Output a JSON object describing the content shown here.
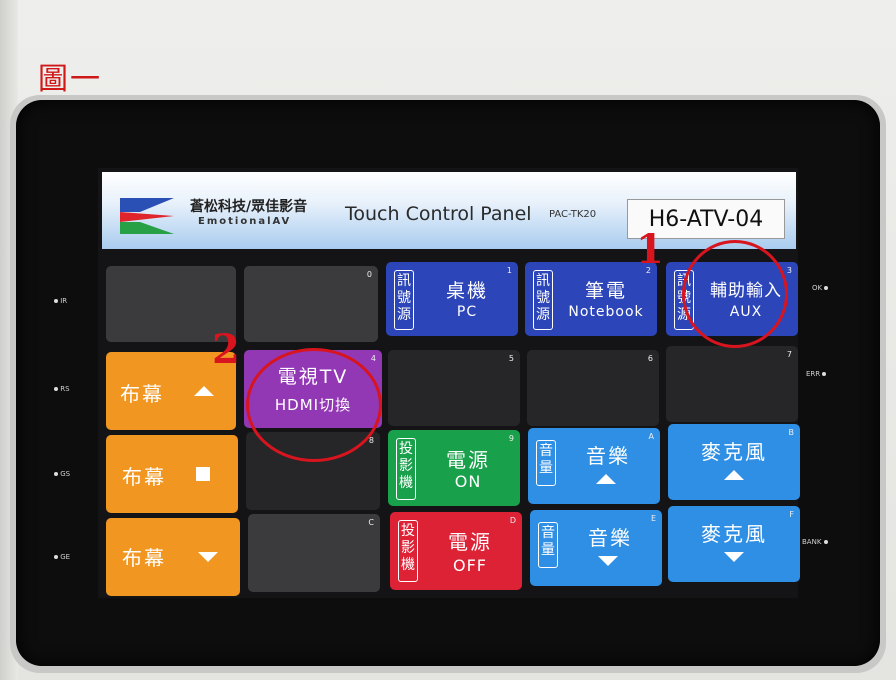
{
  "figure_label": "圖一",
  "panel": {
    "company_cn": "蒼松科技/眾佳影音",
    "company_en": "EmotionalAV",
    "title": "Touch Control Panel",
    "model": "PAC-TK20",
    "device_label": "H6-ATV-04"
  },
  "indicators": [
    "IR",
    "RS",
    "GS",
    "GE",
    "OK",
    "ERR",
    "BANK"
  ],
  "signal_tag": "訊號源",
  "projector_tag": "投影機",
  "volume_tag": "音量",
  "buttons": {
    "desktop": {
      "num": "1",
      "title": "桌機",
      "sub": "PC"
    },
    "notebook": {
      "num": "2",
      "title": "筆電",
      "sub": "Notebook"
    },
    "aux": {
      "num": "3",
      "title": "輔助輸入",
      "sub": "AUX"
    },
    "tv": {
      "num": "4",
      "title": "電視TV",
      "sub": "HDMI切換"
    },
    "screen_up": {
      "label": "布幕"
    },
    "screen_stop": {
      "label": "布幕"
    },
    "screen_down": {
      "label": "布幕"
    },
    "power_on": {
      "num": "9",
      "title": "電源",
      "sub": "ON"
    },
    "power_off": {
      "num": "D",
      "title": "電源",
      "sub": "OFF"
    },
    "music_up": {
      "num": "A",
      "title": "音樂"
    },
    "music_down": {
      "num": "E",
      "title": "音樂"
    },
    "mic_up": {
      "num": "B",
      "title": "麥克風"
    },
    "mic_down": {
      "num": "F",
      "title": "麥克風"
    },
    "blank_0": {
      "num": "0"
    },
    "blank_5": {
      "num": "5"
    },
    "blank_6": {
      "num": "6"
    },
    "blank_7": {
      "num": "7"
    },
    "blank_8": {
      "num": "8"
    },
    "blank_c": {
      "num": "C"
    }
  },
  "annotations": {
    "one": "1",
    "two": "2"
  },
  "colors": {
    "orange": "#f19620",
    "blue": "#2c45b8",
    "sky": "#2f8fe4",
    "purple": "#9238b4",
    "green": "#19a04b",
    "red": "#de2236",
    "annotation": "#d8141e"
  }
}
